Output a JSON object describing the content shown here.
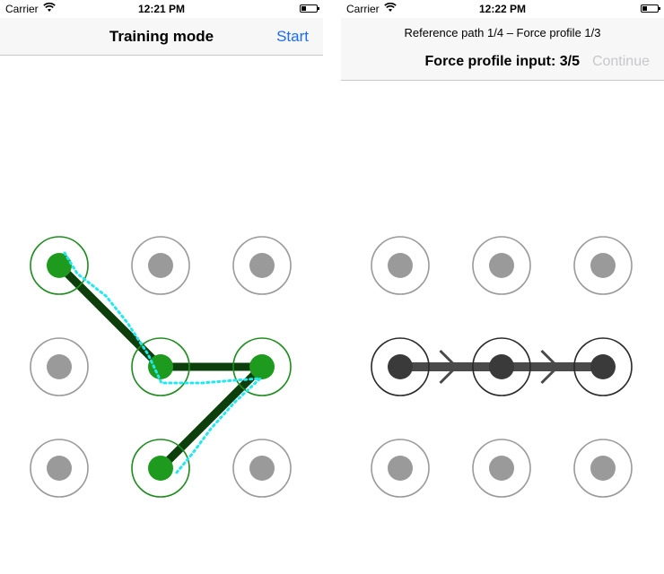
{
  "left_screen": {
    "status": {
      "carrier": "Carrier",
      "time": "12:21 PM"
    },
    "nav": {
      "title": "Training mode",
      "start_label": "Start"
    }
  },
  "right_screen": {
    "status": {
      "carrier": "Carrier",
      "time": "12:22 PM"
    },
    "nav": {
      "reference_label": "Reference path 1/4 – Force profile 1/3",
      "force_input_label": "Force profile input: 3/5",
      "continue_label": "Continue"
    }
  },
  "colors": {
    "active_dot": "#1e9a1e",
    "active_ring": "#1e8c1e",
    "training_line": "#0d3f0d",
    "touch_trace": "#22e8f0",
    "inactive_dot": "#9a9a9a",
    "inactive_ring": "#9a9a9a",
    "reference_dot": "#3a3a3a",
    "reference_ring": "#2a2a2a",
    "reference_line": "#4a4a4a"
  },
  "training_pattern": {
    "selected_sequence": [
      0,
      4,
      5,
      7
    ]
  },
  "reference_pattern": {
    "selected_sequence": [
      3,
      4,
      5
    ]
  }
}
